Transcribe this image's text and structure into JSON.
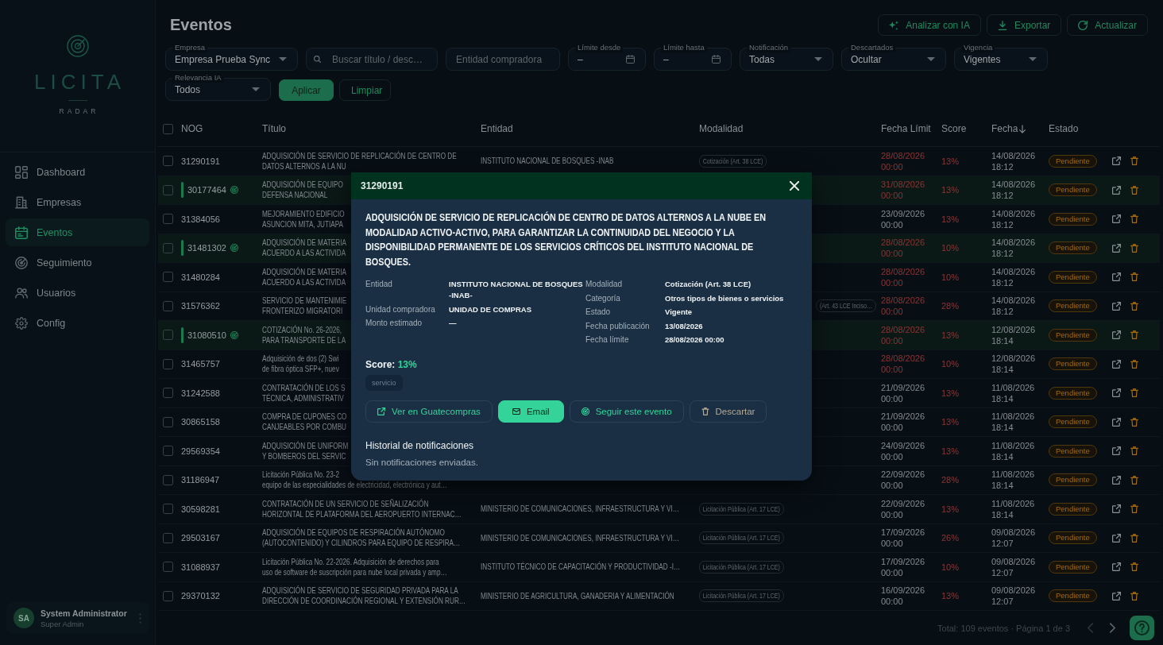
{
  "sidebar": {
    "logo": {
      "wordmark": "LICITA",
      "tagline": "RADAR"
    },
    "nav": [
      {
        "label": "Dashboard",
        "selected": false
      },
      {
        "label": "Empresas",
        "selected": false
      },
      {
        "label": "Eventos",
        "selected": true
      },
      {
        "label": "Seguimiento",
        "selected": false
      },
      {
        "label": "Usuarios",
        "selected": false
      },
      {
        "label": "Config",
        "selected": false
      }
    ],
    "user": {
      "initials": "SA",
      "name": "System Administrator",
      "role": "Super Admin"
    }
  },
  "header": {
    "title": "Eventos",
    "actions": [
      {
        "label": "Analizar con IA"
      },
      {
        "label": "Exportar"
      },
      {
        "label": "Actualizar"
      }
    ]
  },
  "filters": [
    {
      "kind": "select",
      "label": "Empresa",
      "value": "Empresa Prueba Sync"
    },
    {
      "kind": "search",
      "placeholder": "Buscar título / desc…"
    },
    {
      "kind": "text",
      "placeholder": "Entidad compradora"
    },
    {
      "kind": "date",
      "label": "Límite desde",
      "value": "–"
    },
    {
      "kind": "date",
      "label": "Límite hasta",
      "value": "–"
    },
    {
      "kind": "select",
      "label": "Notificación",
      "value": "Todas"
    },
    {
      "kind": "select",
      "label": "Descartados",
      "value": "Ocultar"
    },
    {
      "kind": "select",
      "label": "Vigencia",
      "value": "Vigentes"
    },
    {
      "kind": "select",
      "label": "Relevancia IA",
      "value": "Todos"
    }
  ],
  "filter_buttons": [
    {
      "label": "Aplicar",
      "kind": "primary"
    },
    {
      "label": "Limpiar",
      "kind": "outline"
    }
  ],
  "table": {
    "select_all": {
      "checked": false
    },
    "columns": [
      {
        "label": "NOG",
        "sorted": false
      },
      {
        "label": "Título",
        "sorted": false
      },
      {
        "label": "Entidad",
        "sorted": false
      },
      {
        "label": "Modalidad",
        "sorted": false
      },
      {
        "label": "Fecha Límit",
        "sorted": false
      },
      {
        "label": "Score",
        "sorted": false
      },
      {
        "label": "Fecha",
        "sorted": true
      },
      {
        "label": "Estado",
        "sorted": false
      }
    ],
    "rows": [
      {
        "checked": false,
        "nog": "31290191",
        "followed": false,
        "title": "ADQUISICIÓN DE SERVICIO DE REPLICACIÓN DE CENTRO DE\nDATOS ALTERNOS A LA NU",
        "entity": "INSTITUTO NACIONAL DE BOSQUES -INAB",
        "modality": "Cotización (Art. 38 LCE)",
        "deadline": "28/08/2026 00:00",
        "deadline_overdue": true,
        "score": "13%",
        "date": "14/08/2026 18:12",
        "status": "Pendiente"
      },
      {
        "checked": false,
        "nog": "30177464",
        "followed": true,
        "title": "ADQUISICIÓN DE EQUIPO\nDEFENSA NACIONAL",
        "deadline": "31/08/2026 00:00",
        "deadline_overdue": true,
        "score": "13%",
        "date": "14/08/2026 18:12",
        "status": "Pendiente"
      },
      {
        "checked": false,
        "nog": "31384056",
        "followed": false,
        "title": "MEJORAMIENTO EDIFICIO\nASUNCION MITA, JUTIAPA",
        "deadline": "23/09/2026 00:00",
        "deadline_overdue": false,
        "score": "13%",
        "date": "14/08/2026 18:12",
        "status": "Pendiente"
      },
      {
        "checked": false,
        "nog": "31481302",
        "followed": true,
        "title": "ADQUISICIÓN DE MATERIA\nACUERDO A LAS ACTIVIDA",
        "deadline": "28/08/2026 00:00",
        "deadline_overdue": true,
        "score": "10%",
        "date": "14/08/2026 18:12",
        "status": "Pendiente"
      },
      {
        "checked": false,
        "nog": "31480284",
        "followed": false,
        "title": "ADQUISICIÓN DE MATERIA\nACUERDO A LAS ACTIVIDA",
        "deadline": "28/08/2026 00:00",
        "deadline_overdue": true,
        "score": "10%",
        "date": "14/08/2026 18:12",
        "status": "Pendiente"
      },
      {
        "checked": false,
        "nog": "31576362",
        "followed": false,
        "title": "SERVICIO DE MANTENIMIE\nFRONTERIZO MIGRATORI",
        "modality": "(Art. 43 LCE Inciso…",
        "deadline": "28/08/2026 00:00",
        "deadline_overdue": true,
        "score": "28%",
        "date": "14/08/2026 18:12",
        "status": "Pendiente"
      },
      {
        "checked": false,
        "nog": "31080510",
        "followed": true,
        "title": "COTIZACIÓN No. 26-2026,\nPARA TRANSPORTE DE LA",
        "deadline": "28/08/2026 00:00",
        "deadline_overdue": true,
        "score": "13%",
        "date": "12/08/2026 18:14",
        "status": "Pendiente"
      },
      {
        "checked": false,
        "nog": "31465757",
        "followed": false,
        "title": "Adquisición de dos (2) Swi\nde fibra óptica SFP+, nuev",
        "deadline": "28/08/2026 00:00",
        "deadline_overdue": true,
        "score": "10%",
        "date": "12/08/2026 18:14",
        "status": "Pendiente"
      },
      {
        "checked": false,
        "nog": "31242588",
        "followed": false,
        "title": "CONTRATACIÓN DE LOS S\nTÉCNICA, ADMINISTRATIV",
        "deadline": "21/09/2026 00:00",
        "deadline_overdue": false,
        "score": "13%",
        "date": "11/08/2026 18:14",
        "status": "Pendiente"
      },
      {
        "checked": false,
        "nog": "30865158",
        "followed": false,
        "title": "COMPRA DE CUPONES CO\nCANJEABLES POR COMBU",
        "deadline": "21/09/2026 00:00",
        "deadline_overdue": false,
        "score": "13%",
        "date": "11/08/2026 18:14",
        "status": "Pendiente"
      },
      {
        "checked": false,
        "nog": "29569354",
        "followed": false,
        "title": "ADQUISICIÓN DE UNIFORM\nY BOMBEROS DEL SERVIC",
        "deadline": "24/09/2026 00:00",
        "deadline_overdue": false,
        "score": "13%",
        "date": "11/08/2026 18:14",
        "status": "Pendiente"
      },
      {
        "checked": false,
        "nog": "31186947",
        "followed": false,
        "title": "Licitación Pública No. 23-2\nequipo de las especialidades de electricidad, electrónica y aut…",
        "deadline": "22/09/2026 00:00",
        "deadline_overdue": false,
        "score": "28%",
        "date": "11/08/2026 18:14",
        "status": "Pendiente"
      },
      {
        "checked": false,
        "nog": "30598281",
        "followed": false,
        "title": "CONTRATACIÓN DE UN SERVICIO DE SEÑALIZACIÓN\nHORIZONTAL DE PLATAFORMA DEL AEROPUERTO INTERNAC…",
        "entity": "MINISTERIO DE COMUNICACIONES, INFRAESTRUCTURA Y VI…",
        "modality": "Licitación Pública (Art. 17 LCE)",
        "deadline": "22/09/2026 00:00",
        "deadline_overdue": false,
        "score": "13%",
        "date": "11/08/2026 18:14",
        "status": "Pendiente"
      },
      {
        "checked": false,
        "nog": "29503167",
        "followed": false,
        "title": "ADQUISICIÓN DE EQUIPOS DE RESPIRACIÓN AUTÓNOMO\n(AUTOCONTENIDO) Y CILINDROS PARA EQUIPO DE RESPIRA…",
        "entity": "MINISTERIO DE COMUNICACIONES, INFRAESTRUCTURA Y VI…",
        "modality": "Licitación Pública (Art. 17 LCE)",
        "deadline": "17/09/2026 00:00",
        "deadline_overdue": false,
        "score": "26%",
        "date": "09/08/2026 12:07",
        "status": "Pendiente"
      },
      {
        "checked": false,
        "nog": "31088937",
        "followed": false,
        "title": "Licitación Pública No. 22-2026. Adquisición de derechos para\nuso de software de suscripción para nube local privada y amp…",
        "entity": "INSTITUTO TÉCNICO DE CAPACITACIÓN Y PRODUCTIVIDAD -I…",
        "modality": "Licitación Pública (Art. 17 LCE)",
        "deadline": "17/09/2026 00:00",
        "deadline_overdue": false,
        "score": "10%",
        "date": "09/08/2026 12:07",
        "status": "Pendiente"
      },
      {
        "checked": false,
        "nog": "29370132",
        "followed": false,
        "title": "ADQUISICIÓN DE SERVICIO DE SEGURIDAD PRIVADA PARA LA\nDIRECCIÓN DE COORDINACIÓN REGIONAL Y EXTENSIÓN RUR…",
        "entity": "MINISTERIO DE AGRICULTURA, GANADERIA Y ALIMENTACIÓN",
        "modality": "Licitación Pública (Art. 17 LCE)",
        "deadline": "16/09/2026 00:00",
        "deadline_overdue": false,
        "score": "13%",
        "date": "09/08/2026 12:07",
        "status": "Pendiente"
      }
    ]
  },
  "pagination": {
    "summary": "Total: 109 eventos · Página 1 de 3",
    "previous": {
      "disabled": true
    },
    "next": {
      "disabled": false
    }
  },
  "modal": {
    "number": "31290191",
    "title": "ADQUISICIÓN DE SERVICIO DE REPLICACIÓN DE CENTRO DE DATOS ALTERNOS A LA NUBE EN MODALIDAD ACTIVO-ACTIVO, PARA GARANTIZAR LA CONTINUIDAD DEL NEGOCIO Y LA DISPONIBILIDAD PERMANENTE DE LOS SERVICIOS CRÍTICOS DEL INSTITUTO NACIONAL DE BOSQUES.",
    "details_left": [
      {
        "label": "Entidad",
        "value": "INSTITUTO NACIONAL DE BOSQUES -INAB-"
      },
      {
        "label": "Unidad compradora",
        "value": "UNIDAD DE COMPRAS"
      },
      {
        "label": "Monto estimado",
        "value": "—"
      }
    ],
    "details_right": [
      {
        "label": "Modalidad",
        "value": "Cotización (Art. 38 LCE)"
      },
      {
        "label": "Categoría",
        "value": "Otros tipos de bienes o servicios"
      },
      {
        "label": "Estado",
        "value": "Vigente"
      },
      {
        "label": "Fecha publicación",
        "value": "13/08/2026"
      },
      {
        "label": "Fecha límite",
        "value": "28/08/2026 00:00"
      }
    ],
    "score": {
      "label": "Score:",
      "value": "13%"
    },
    "tags": [
      "servicio"
    ],
    "actions": [
      {
        "label": "Ver en Guatecompras",
        "kind": "outline"
      },
      {
        "label": "Email",
        "kind": "primary"
      },
      {
        "label": "Seguir este evento",
        "kind": "outline"
      },
      {
        "label": "Descartar",
        "kind": "muted"
      }
    ],
    "history": {
      "title": "Historial de notificaciones",
      "empty": "Sin notificaciones enviadas."
    }
  }
}
